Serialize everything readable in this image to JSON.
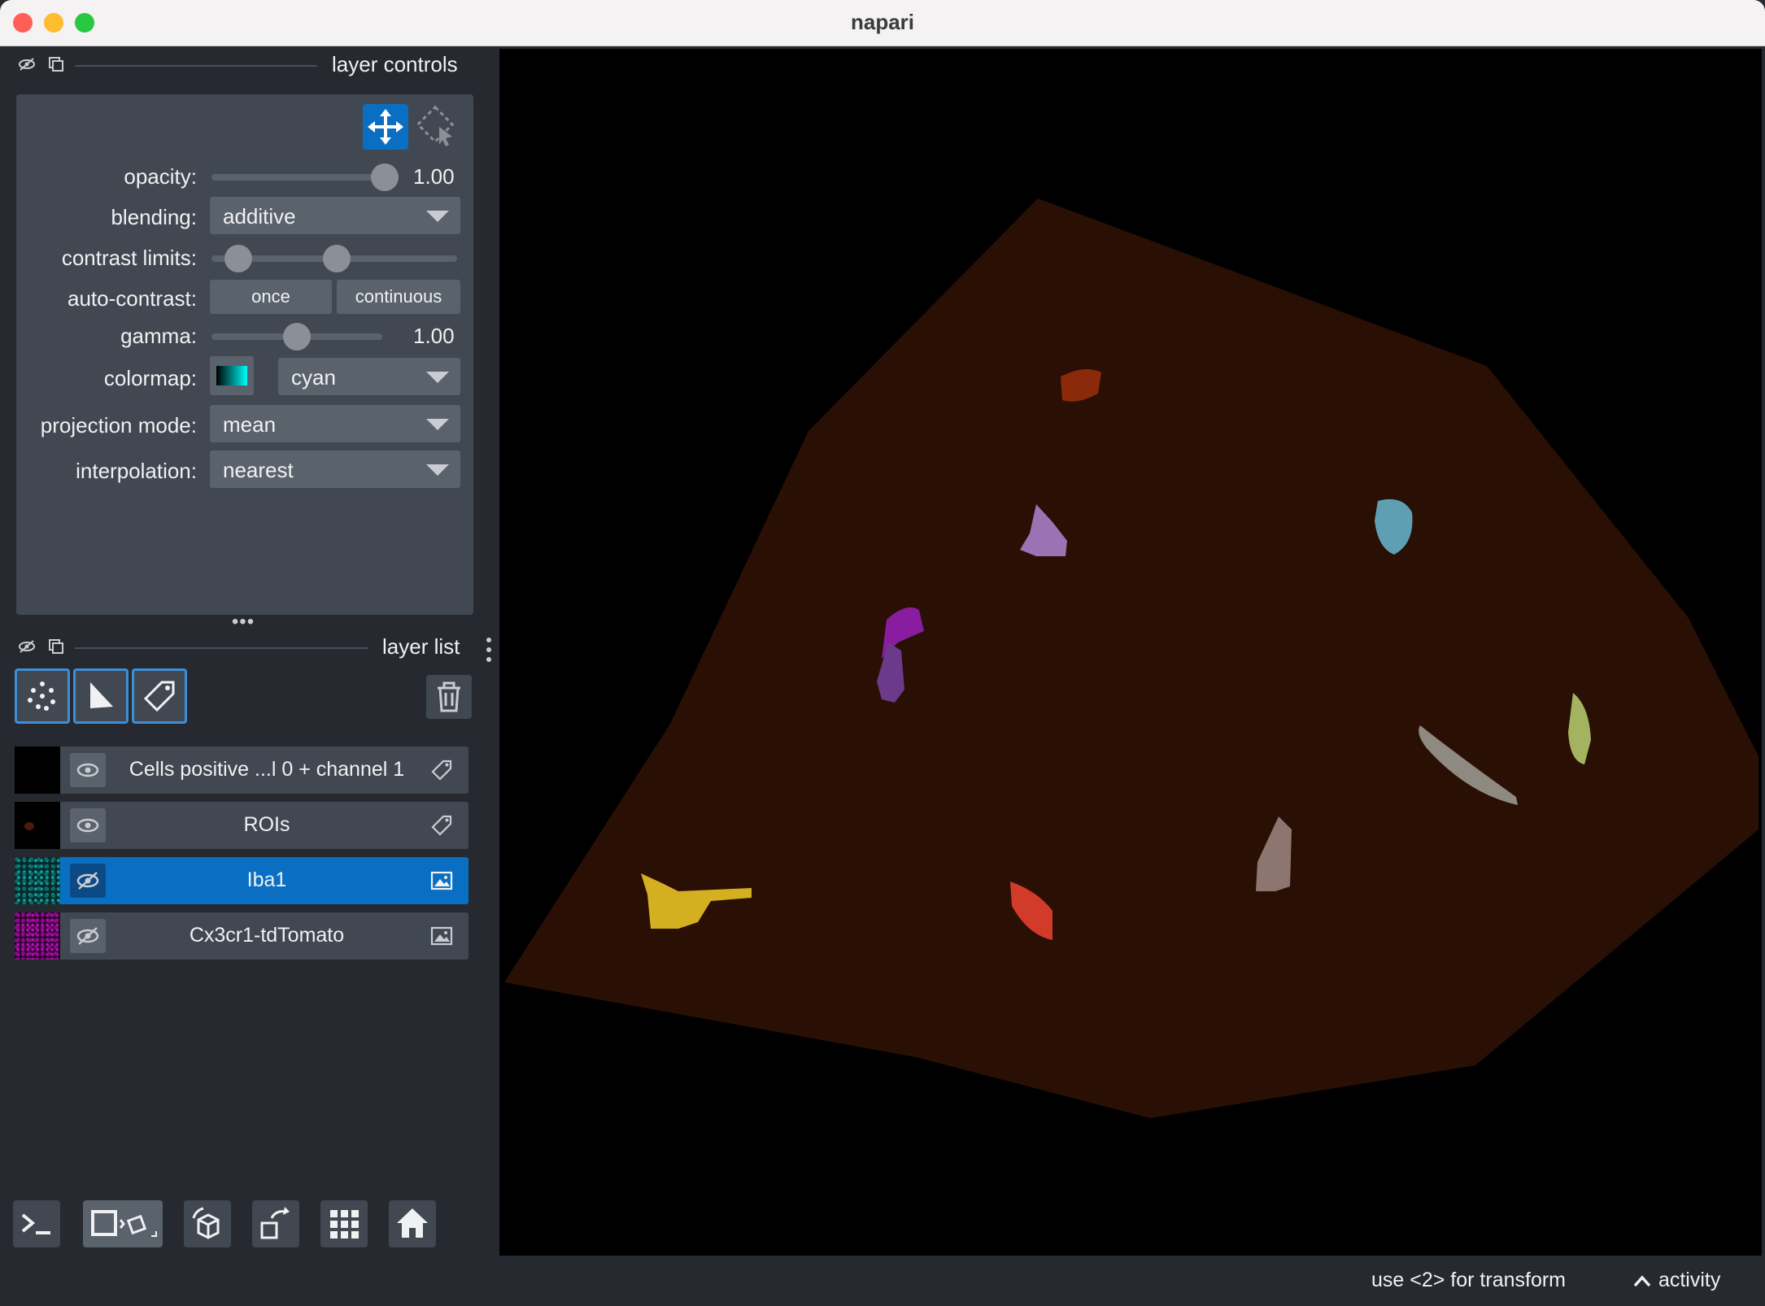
{
  "window": {
    "title": "napari"
  },
  "layer_controls": {
    "header": "layer controls",
    "opacity": {
      "label": "opacity:",
      "value": "1.00",
      "fraction": 1.0
    },
    "blending": {
      "label": "blending:",
      "value": "additive"
    },
    "contrast_limits": {
      "label": "contrast limits:",
      "low_fraction": 0.0,
      "high_fraction": 0.45
    },
    "auto_contrast": {
      "label": "auto-contrast:",
      "once": "once",
      "continuous": "continuous"
    },
    "gamma": {
      "label": "gamma:",
      "value": "1.00",
      "fraction": 0.45
    },
    "colormap": {
      "label": "colormap:",
      "value": "cyan"
    },
    "projection_mode": {
      "label": "projection mode:",
      "value": "mean"
    },
    "interpolation": {
      "label": "interpolation:",
      "value": "nearest"
    }
  },
  "layer_list": {
    "header": "layer list",
    "layers": [
      {
        "name": "Cells positive ...l 0 + channel 1",
        "type": "labels",
        "visible": true,
        "selected": false
      },
      {
        "name": "ROIs",
        "type": "labels",
        "visible": true,
        "selected": false
      },
      {
        "name": "Iba1",
        "type": "image",
        "visible": false,
        "selected": true
      },
      {
        "name": "Cx3cr1-tdTomato",
        "type": "image",
        "visible": false,
        "selected": false
      }
    ]
  },
  "status": {
    "hint": "use <2> for transform",
    "activity": "activity"
  },
  "colors": {
    "accent": "#0a6fc2",
    "panel": "#414851",
    "background": "#262930",
    "region": "#2a0f05"
  }
}
